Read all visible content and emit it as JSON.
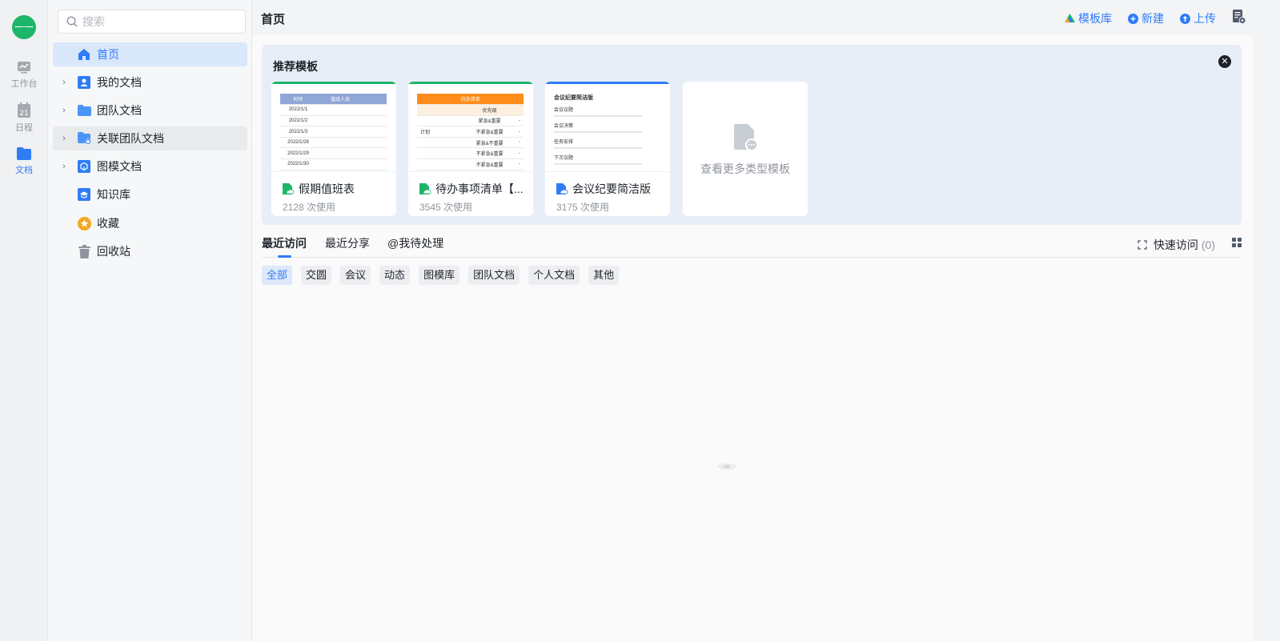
{
  "rail": {
    "avatar_text": "一一",
    "items": [
      {
        "label": "工作台",
        "icon": "workbench-icon"
      },
      {
        "label": "日程",
        "icon": "calendar-icon",
        "day": "21"
      },
      {
        "label": "文档",
        "icon": "folder-icon"
      }
    ]
  },
  "nav": {
    "search_placeholder": "搜索",
    "items": [
      {
        "label": "首页",
        "icon": "home-icon",
        "active": true
      },
      {
        "label": "我的文档",
        "icon": "my-docs-icon",
        "expandable": true
      },
      {
        "label": "团队文档",
        "icon": "folder-icon",
        "expandable": true
      },
      {
        "label": "关联团队文档",
        "icon": "linked-folder-icon",
        "expandable": true
      },
      {
        "label": "图模文档",
        "icon": "model-docs-icon",
        "expandable": true
      },
      {
        "label": "知识库",
        "icon": "knowledge-icon"
      },
      {
        "label": "收藏",
        "icon": "star-icon"
      },
      {
        "label": "回收站",
        "icon": "trash-icon"
      }
    ]
  },
  "header": {
    "title": "首页",
    "template_lib": "模板库",
    "new": "新建",
    "upload": "上传"
  },
  "recommend": {
    "title": "推荐模板",
    "close": "✕",
    "cards": [
      {
        "name": "假期值班表",
        "uses": "2128 次使用",
        "accent": "#1db56a",
        "preview_header": [
          "时间",
          "值班人员"
        ],
        "preview_rows": [
          "2022/1/1",
          "2022/1/2",
          "2022/1/3",
          "2022/1/28",
          "2022/1/29",
          "2022/1/30"
        ]
      },
      {
        "name": "待办事项清单【...",
        "uses": "3545 次使用",
        "accent": "#1db56a",
        "preview_header": "待办清单",
        "preview_sub": "优先级",
        "preview_side": "计划",
        "preview_rows": [
          "紧急&重要",
          "不紧急&重要",
          "紧急&不重要",
          "不紧急&重要",
          "不紧急&重要"
        ]
      },
      {
        "name": "会议纪要简洁版",
        "uses": "3175 次使用",
        "accent": "#2f7cf6",
        "preview_title": "会议纪要简洁版",
        "preview_sections": [
          "会议议题",
          "会议决策",
          "任务安排",
          "下次议题"
        ]
      }
    ],
    "more_label": "查看更多类型模板"
  },
  "tabs": {
    "items": [
      "最近访问",
      "最近分享",
      "@我待处理"
    ],
    "quick_label": "快速访问",
    "quick_count": "(0)"
  },
  "filters": [
    "全部",
    "交圆",
    "会议",
    "动态",
    "图模库",
    "团队文档",
    "个人文档",
    "其他"
  ],
  "colors": {
    "accent": "#2f7cf6",
    "green": "#1db56a",
    "orange": "#ff8c1a"
  }
}
